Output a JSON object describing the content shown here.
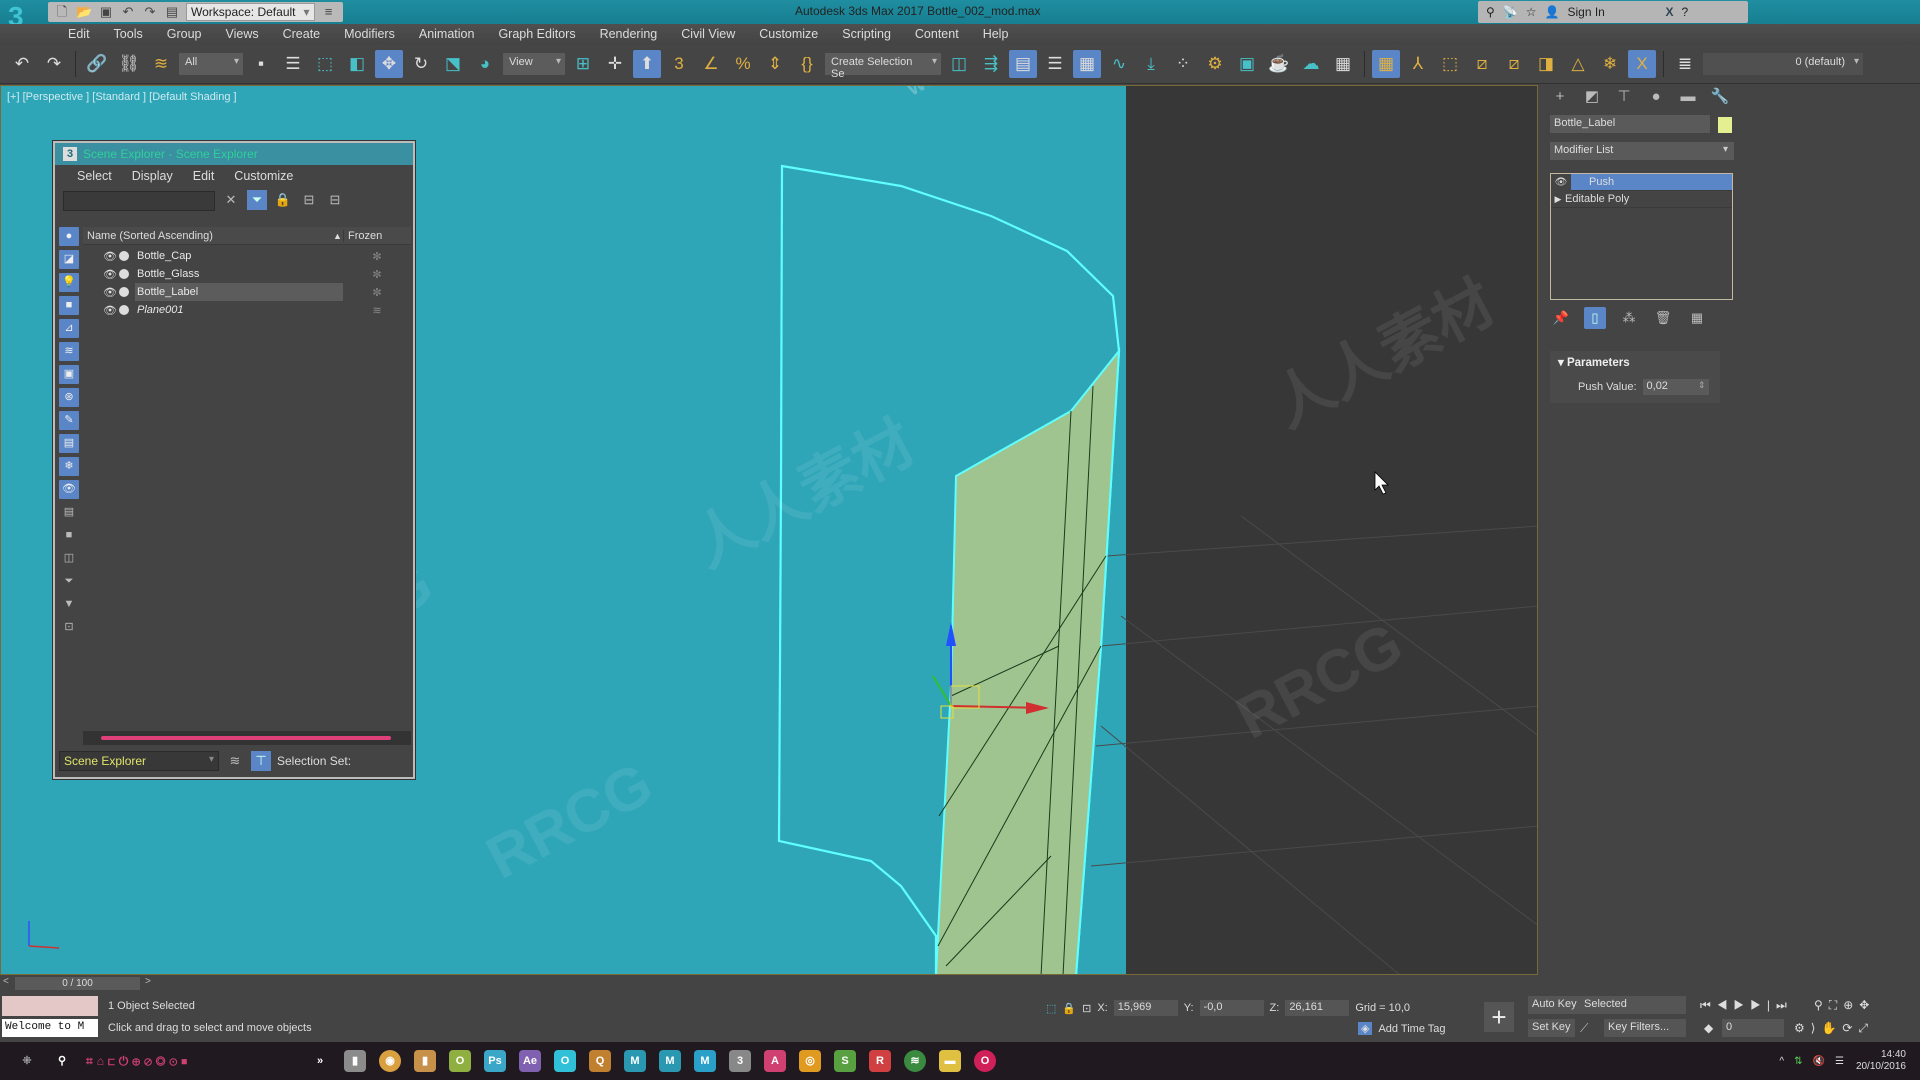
{
  "titlebar": {
    "app_logo": "3",
    "workspace": "Workspace: Default",
    "title": "Autodesk 3ds Max 2017    Bottle_002_mod.max",
    "sign_in": "Sign In",
    "qat_icons": [
      "new-file-icon",
      "open-file-icon",
      "save-icon",
      "undo-icon",
      "redo-icon",
      "project-folder-icon"
    ],
    "infocenter_icons": [
      "search-binoculars-icon",
      "communication-center-icon",
      "favorites-star-icon",
      "user-icon",
      "exchange-x-icon",
      "help-icon"
    ]
  },
  "menubar": {
    "items": [
      "Edit",
      "Tools",
      "Group",
      "Views",
      "Create",
      "Modifiers",
      "Animation",
      "Graph Editors",
      "Rendering",
      "Civil View",
      "Customize",
      "Scripting",
      "Content",
      "Help"
    ]
  },
  "toolbar": {
    "selection_filter": "All",
    "reference_coord": "View",
    "named_selection": "Create Selection Se",
    "layer": "0 (default)"
  },
  "viewport": {
    "label": "[+] [Perspective ] [Standard ] [Default Shading ]",
    "colors": {
      "background": "#2fa6b8",
      "grid_area": "#373737",
      "label_mesh": "#9fc490",
      "selection_outline": "#5fffff"
    }
  },
  "scene_explorer": {
    "title": "Scene Explorer - Scene Explorer",
    "menu": [
      "Select",
      "Display",
      "Edit",
      "Customize"
    ],
    "search_value": "",
    "columns": {
      "name": "Name (Sorted Ascending)",
      "frozen": "Frozen"
    },
    "rows": [
      {
        "name": "Bottle_Cap",
        "frozen_icon": "✼",
        "selected": false,
        "italic": false
      },
      {
        "name": "Bottle_Glass",
        "frozen_icon": "✼",
        "selected": false,
        "italic": false
      },
      {
        "name": "Bottle_Label",
        "frozen_icon": "✼",
        "selected": true,
        "italic": false
      },
      {
        "name": "Plane001",
        "frozen_icon": "≋",
        "selected": false,
        "italic": true
      }
    ],
    "footer_combo": "Scene Explorer",
    "selection_set_label": "Selection Set:"
  },
  "command_panel": {
    "object_name": "Bottle_Label",
    "object_color": "#e4ef92",
    "modifier_list": "Modifier List",
    "stack": [
      {
        "name": "Push",
        "selected": true
      },
      {
        "name": "Editable Poly",
        "selected": false
      }
    ],
    "rollout_title": "Parameters",
    "push_value_label": "Push Value:",
    "push_value": "0,02"
  },
  "timeline": {
    "frame": "0 / 100",
    "prev": "<",
    "next": ">"
  },
  "status": {
    "maxscript_text": "Welcome to M",
    "line1": "1 Object Selected",
    "line2": "Click and drag to select and move objects",
    "x_label": "X:",
    "x_value": "15,969",
    "y_label": "Y:",
    "y_value": "-0,0",
    "z_label": "Z:",
    "z_value": "26,161",
    "grid": "Grid = 10,0",
    "add_time_tag": "Add Time Tag",
    "auto_key": "Auto Key",
    "set_key": "Set Key",
    "selected_dropdown": "Selected",
    "key_filters": "Key Filters...",
    "current_frame": "0"
  },
  "taskbar": {
    "time": "14:40",
    "date": "20/10/2016",
    "apps": [
      {
        "name": "file-manager",
        "color": "#8b8b8b",
        "glyph": "▮"
      },
      {
        "name": "chrome",
        "color": "#d9a040",
        "glyph": "◉"
      },
      {
        "name": "notes",
        "color": "#c8914a",
        "glyph": "▮"
      },
      {
        "name": "app-green",
        "color": "#8fb040",
        "glyph": "O"
      },
      {
        "name": "photoshop",
        "color": "#3aa6c8",
        "glyph": "Ps"
      },
      {
        "name": "after-effects",
        "color": "#8060b0",
        "glyph": "Ae"
      },
      {
        "name": "app-cyan",
        "color": "#30c0d8",
        "glyph": "O"
      },
      {
        "name": "app-orange",
        "color": "#c08030",
        "glyph": "Q"
      },
      {
        "name": "maya",
        "color": "#2a98b0",
        "glyph": "M"
      },
      {
        "name": "maya-2",
        "color": "#2a98b0",
        "glyph": "M"
      },
      {
        "name": "mudbox",
        "color": "#2aa0c8",
        "glyph": "M"
      },
      {
        "name": "3ds-max",
        "color": "#888888",
        "glyph": "3"
      },
      {
        "name": "app-pink",
        "color": "#d04070",
        "glyph": "A"
      },
      {
        "name": "app-amber",
        "color": "#e09a20",
        "glyph": "◎"
      },
      {
        "name": "app-lime",
        "color": "#58a040",
        "glyph": "S"
      },
      {
        "name": "app-red",
        "color": "#d04040",
        "glyph": "R"
      },
      {
        "name": "spotify",
        "color": "#3a8a40",
        "glyph": "≋"
      },
      {
        "name": "explorer",
        "color": "#e0c040",
        "glyph": "▬"
      },
      {
        "name": "app-magenta",
        "color": "#d0205a",
        "glyph": "O"
      }
    ]
  },
  "watermarks": [
    "RRCG",
    "人人素材",
    "www.rrcg.cn"
  ]
}
